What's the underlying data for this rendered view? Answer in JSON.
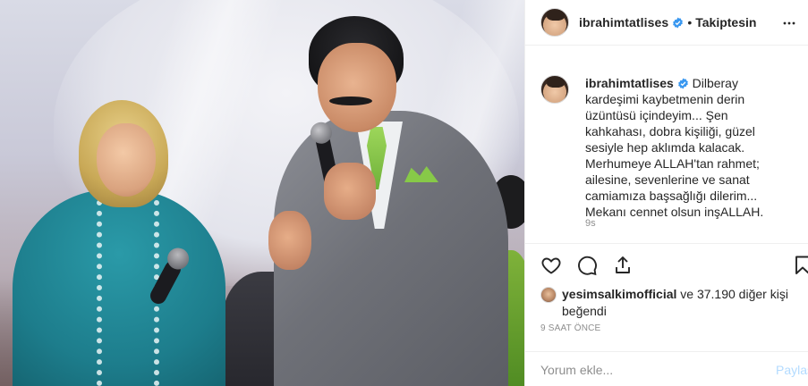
{
  "post": {
    "username": "ibrahimtatlises",
    "follow_label": "Takiptesin",
    "dot": "•",
    "caption_user": "ibrahimtatlises",
    "caption_text": "Dilberay kardeşimi kaybetmenin derin üzüntüsü içindeyim... Şen kahkahası, dobra kişiliği, güzel sesiyle hep aklımda kalacak. Merhumeye ALLAH'tan rahmet; ailesine, sevenlerine ve sanat camiamıza başsağlığı dilerim... Mekanı cennet olsun inşALLAH.",
    "caption_time": "9s",
    "likes_user": "yesimsalkimofficial",
    "likes_rest": " ve 37.190 diğer kişi",
    "likes_line2": "beğendi",
    "post_time": "9 SAAT ÖNCE"
  },
  "comment": {
    "placeholder": "Yorum ekle...",
    "share_label": "Paylaş"
  },
  "icons": {
    "more": "more-icon",
    "verified": "verified-badge-icon",
    "like": "heart-icon",
    "comment": "comment-icon",
    "share": "share-icon",
    "save": "bookmark-icon"
  },
  "colors": {
    "verified": "#3897f0",
    "text": "#262626",
    "muted": "#8e8e8e",
    "share_disabled": "#b3dbff"
  }
}
